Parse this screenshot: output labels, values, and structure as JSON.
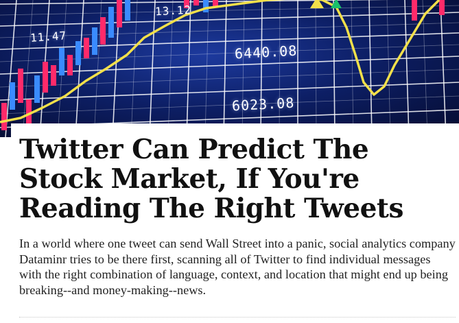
{
  "hero": {
    "numbers": [
      "13.12",
      "11.47",
      "6440.08",
      "6023.08"
    ]
  },
  "article": {
    "headline": "Twitter Can Predict The Stock Market, If You're Reading The Right Tweets",
    "dek": "In a world where one tweet can send Wall Street into a panic, social analytics company Dataminr tries to be there first, scanning all of Twitter to find individual messages with the right combination of language, context, and location that might end up being breaking--and money-making--news."
  }
}
